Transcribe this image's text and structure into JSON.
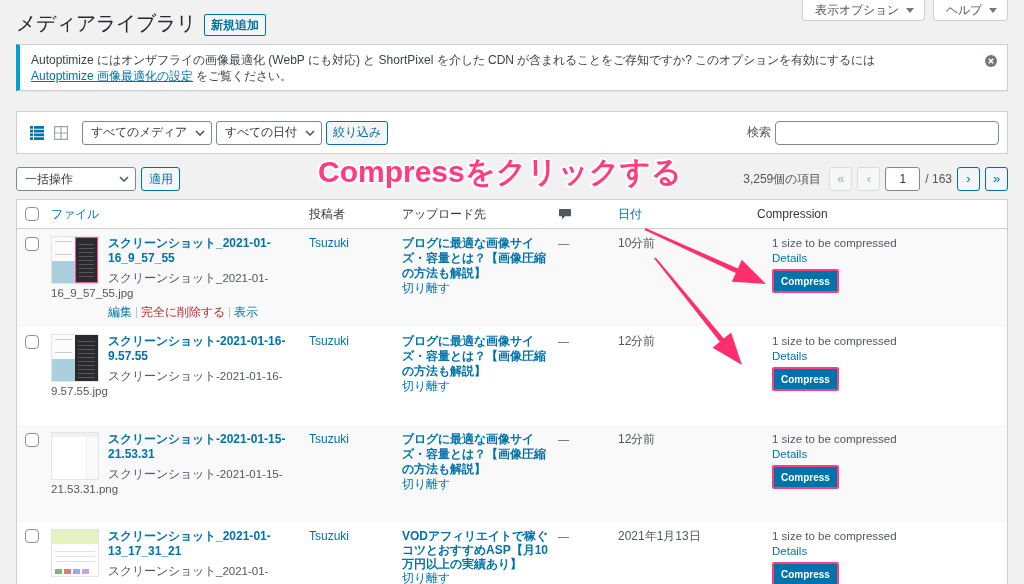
{
  "page": {
    "title": "メディアライブラリ",
    "add_button": "新規追加"
  },
  "screen_meta": [
    {
      "label": "表示オプション"
    },
    {
      "label": "ヘルプ"
    }
  ],
  "notice": {
    "text_before": "Autoptimize にはオンザフライの画像最適化 (WebP にも対応) と ShortPixel を介した CDN が含まれることをご存知ですか? このオプションを有効にするには ",
    "link": "Autoptimize 画像最適化の設定",
    "text_after": " をご覧ください。"
  },
  "filter_bar": {
    "views": [
      {
        "kind": "list",
        "selected": true
      },
      {
        "kind": "grid",
        "selected": false
      }
    ],
    "media_filter": "すべてのメディア",
    "date_filter": "すべての日付",
    "filter_button": "絞り込み",
    "search_label": "検索"
  },
  "bulk_actions": {
    "select": "一括操作",
    "apply_button": "適用"
  },
  "callout": {
    "text": "Compressをクリックする"
  },
  "pagination": {
    "count": "3,259個の項目",
    "first": {
      "label": "«",
      "disabled": true
    },
    "prev": {
      "label": "‹",
      "disabled": true
    },
    "current_page": "1",
    "total_pages": "/ 163",
    "next": {
      "label": "›",
      "disabled": false
    },
    "last": {
      "label": "»",
      "disabled": false
    }
  },
  "table": {
    "header_checkbox": {
      "checked": false
    },
    "columns": [
      {
        "kind": "text",
        "label": "ファイル",
        "sortable": true
      },
      {
        "kind": "text",
        "label": "投稿者",
        "sortable": false
      },
      {
        "kind": "text",
        "label": "アップロード先",
        "sortable": false
      },
      {
        "kind": "icon"
      },
      {
        "kind": "text",
        "label": "日付",
        "sortable": true
      },
      {
        "kind": "text",
        "label": "Compression",
        "sortable": false
      }
    ],
    "rows": [
      {
        "checked": false,
        "thumbnail": {
          "kind": "split-marked"
        },
        "title": "スクリーンショット_2021-01-16_9_57_55",
        "filename": "スクリーンショット_2021-01-16_9_57_55.jpg",
        "actions": [
          {
            "kind": "link",
            "label": "編集"
          },
          {
            "kind": "delete",
            "label": "完全に削除する"
          },
          {
            "kind": "link",
            "label": "表示"
          }
        ],
        "author": "Tsuzuki",
        "uploaded_to": "ブログに最適な画像サイズ・容量とは？【画像圧縮の方法も解説】",
        "detach": "切り離す",
        "comments": "—",
        "date": "10分前",
        "compression": {
          "status": "1 size to be compressed",
          "details": "Details",
          "button": "Compress",
          "highlighted": true
        }
      },
      {
        "checked": false,
        "thumbnail": {
          "kind": "split"
        },
        "title": "スクリーンショット-2021-01-16-9.57.55",
        "filename": "スクリーンショット-2021-01-16-9.57.55.jpg",
        "author": "Tsuzuki",
        "uploaded_to": "ブログに最適な画像サイズ・容量とは？【画像圧縮の方法も解説】",
        "detach": "切り離す",
        "comments": "—",
        "date": "12分前",
        "compression": {
          "status": "1 size to be compressed",
          "details": "Details",
          "button": "Compress",
          "highlighted": true
        }
      },
      {
        "checked": false,
        "thumbnail": {
          "kind": "blank"
        },
        "title": "スクリーンショット-2021-01-15-21.53.31",
        "filename": "スクリーンショット-2021-01-15-21.53.31.png",
        "author": "Tsuzuki",
        "uploaded_to": "ブログに最適な画像サイズ・容量とは？【画像圧縮の方法も解説】",
        "detach": "切り離す",
        "comments": "—",
        "date": "12分前",
        "compression": {
          "status": "1 size to be compressed",
          "details": "Details",
          "button": "Compress",
          "highlighted": true
        }
      },
      {
        "checked": false,
        "thumbnail": {
          "kind": "banner"
        },
        "title": "スクリーンショット_2021-01-13_17_31_21",
        "filename": "スクリーンショット_2021-01-",
        "author": "Tsuzuki",
        "uploaded_to": "VODアフィリエイトで稼ぐコツとおすすめASP【月10万円以上の実績あり】",
        "detach": "切り離す",
        "comments": "—",
        "date": "2021年1月13日",
        "compression": {
          "status": "1 size to be compressed",
          "details": "Details",
          "button": "Compress",
          "highlighted": true
        }
      }
    ]
  }
}
